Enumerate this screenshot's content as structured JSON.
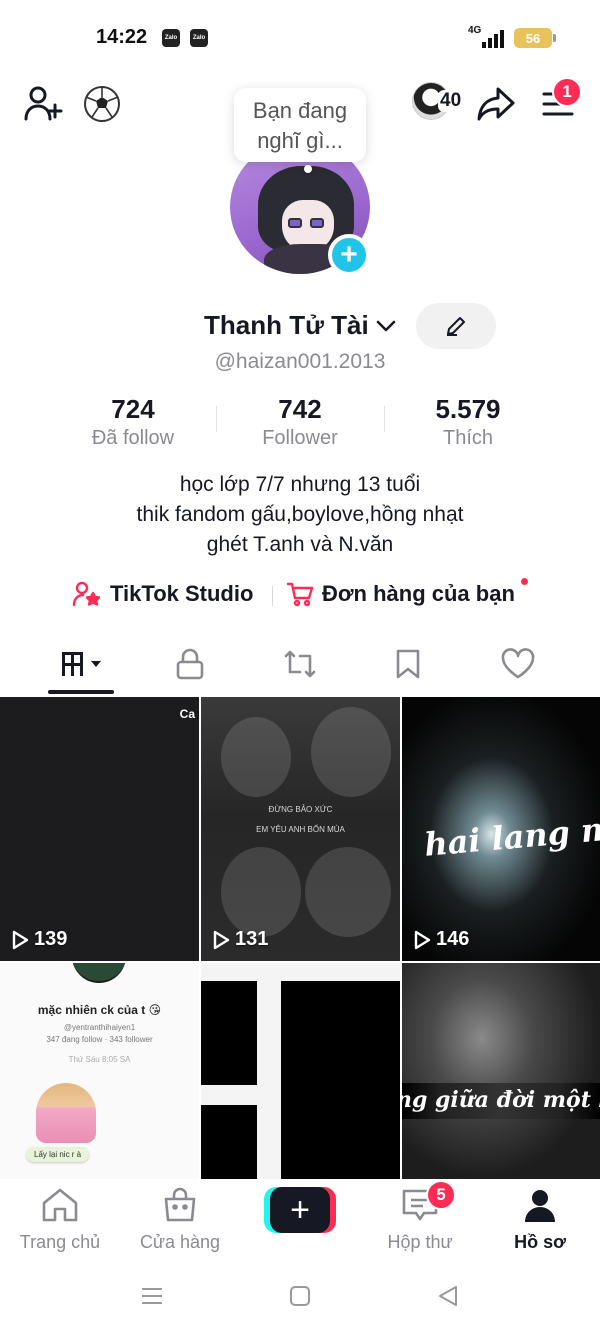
{
  "status_bar": {
    "time": "14:22",
    "app_icons": [
      "Zalo",
      "Zalo"
    ],
    "network": "4G",
    "battery": "56"
  },
  "top_bar": {
    "viewer_count": "40",
    "notification_count": "1",
    "icons": [
      "add-friend-icon",
      "soccer-ball-icon",
      "share-icon",
      "menu-icon"
    ]
  },
  "thought_bubble": {
    "line1": "Bạn đang",
    "line2": "nghĩ gì..."
  },
  "profile": {
    "display_name": "Thanh Tử Tài",
    "username": "@haizan001.2013",
    "stats": [
      {
        "value": "724",
        "label": "Đã follow"
      },
      {
        "value": "742",
        "label": "Follower"
      },
      {
        "value": "5.579",
        "label": "Thích"
      }
    ],
    "bio": [
      "học lớp 7/7 nhưng 13 tuổi",
      "thik fandom gấu,boylove,hồng nhạt",
      "ghét T.anh và N.văn"
    ]
  },
  "links": {
    "studio": "TikTok Studio",
    "orders": "Đơn hàng của bạn"
  },
  "videos": [
    {
      "plays": "139",
      "overlay": "Ca"
    },
    {
      "plays": "131",
      "overlay": "EM YÊU ANH BỐN MÙA",
      "overlay2": "ĐỪNG BẢO XỨC"
    },
    {
      "plays": "146",
      "overlay": "hai lang mực\""
    },
    {
      "title": "mặc nhiên ck của t 😘",
      "handle": "@yentranthihaiyen1",
      "meta": "347 đang follow · 343 follower",
      "date": "Thứ Sáu 8:05 SA",
      "pill": "Lấy lại nic r à"
    },
    {},
    {
      "overlay": "ng giữa đời một bức"
    }
  ],
  "bottom_nav": {
    "home": "Trang chủ",
    "shop": "Cửa hàng",
    "inbox": "Hộp thư",
    "inbox_badge": "5",
    "profile": "Hồ sơ"
  },
  "colors": {
    "accent": "#fe2c55",
    "cyan": "#25f4ee",
    "plus_button": "#20c4e8"
  }
}
